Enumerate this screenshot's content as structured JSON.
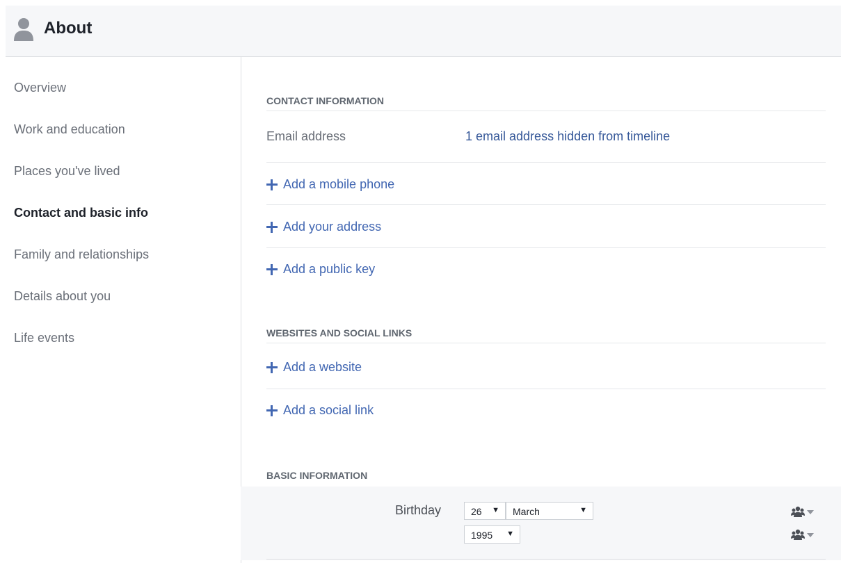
{
  "header": {
    "title": "About",
    "icon": "person-icon"
  },
  "sidebar": {
    "items": [
      {
        "label": "Overview",
        "active": false
      },
      {
        "label": "Work and education",
        "active": false
      },
      {
        "label": "Places you've lived",
        "active": false
      },
      {
        "label": "Contact and basic info",
        "active": true
      },
      {
        "label": "Family and relationships",
        "active": false
      },
      {
        "label": "Details about you",
        "active": false
      },
      {
        "label": "Life events",
        "active": false
      }
    ]
  },
  "contact": {
    "title": "CONTACT INFORMATION",
    "email_label": "Email address",
    "email_value": "1 email address hidden from timeline",
    "add_mobile": "Add a mobile phone",
    "add_address": "Add your address",
    "add_public_key": "Add a public key"
  },
  "websites": {
    "title": "WEBSITES AND SOCIAL LINKS",
    "add_website": "Add a website",
    "add_social": "Add a social link"
  },
  "basic": {
    "title": "BASIC INFORMATION",
    "birthday_label": "Birthday",
    "day": "26",
    "month": "March",
    "year": "1995",
    "audience_icon": "friends-icon"
  },
  "colors": {
    "link": "#4267b2",
    "header_bg": "#f6f7f9",
    "muted_text": "#6a6f78"
  }
}
